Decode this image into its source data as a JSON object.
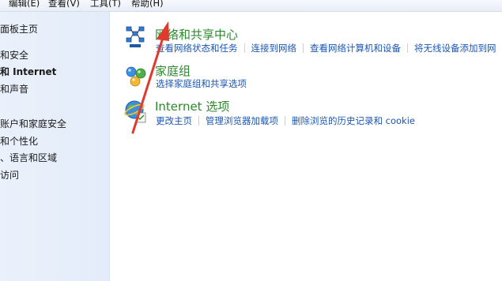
{
  "menubar": {
    "items": [
      "编辑(E)",
      "查看(V)",
      "工具(T)",
      "帮助(H)"
    ]
  },
  "sidebar": {
    "items": [
      {
        "label": "面板主页"
      },
      {
        "label": "和安全"
      },
      {
        "label": "和 Internet"
      },
      {
        "label": "和声音"
      },
      {
        "label": "账户和家庭安全"
      },
      {
        "label": "和个性化"
      },
      {
        "label": "、语言和区域"
      },
      {
        "label": "访问"
      }
    ]
  },
  "categories": [
    {
      "title": "网络和共享中心",
      "icon": "network-center-icon",
      "links": [
        "查看网络状态和任务",
        "连接到网络",
        "查看网络计算机和设备",
        "将无线设备添加到网"
      ]
    },
    {
      "title": "家庭组",
      "icon": "homegroup-icon",
      "links": [
        "选择家庭组和共享选项"
      ]
    },
    {
      "title": "Internet 选项",
      "icon": "internet-options-icon",
      "links": [
        "更改主页",
        "管理浏览器加载项",
        "删除浏览的历史记录和 cookie"
      ]
    }
  ],
  "annotation": {
    "color": "#e03a2e"
  }
}
